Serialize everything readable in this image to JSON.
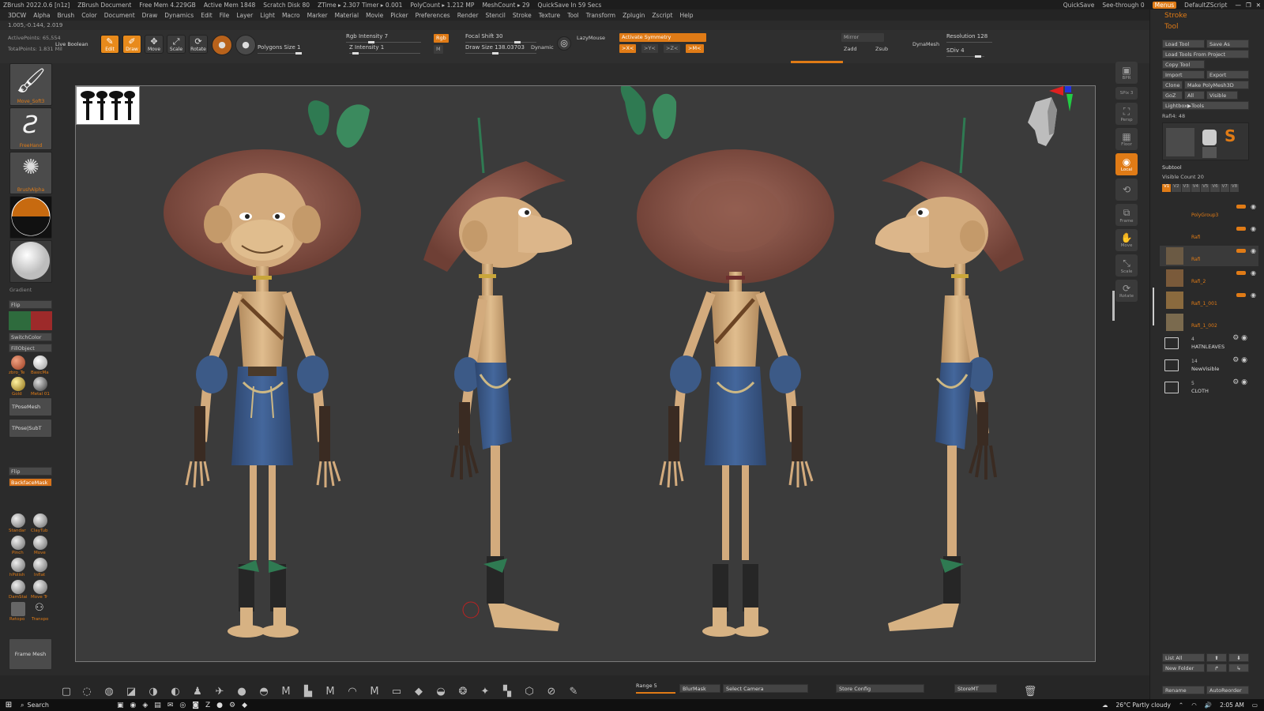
{
  "title_bar": {
    "app": "ZBrush 2022.0.6 [n1z]",
    "document": "ZBrush Document",
    "free_mem": "Free Mem 4.229GB",
    "active_mem": "Active Mem 1848",
    "scratch_disk": "Scratch Disk 80",
    "ztime": "ZTime ▸ 2.307 Timer ▸ 0.001",
    "polycount": "PolyCount ▸ 1.212 MP",
    "meshcount": "MeshCount ▸ 29",
    "quicksave": "QuickSave In 59 Secs",
    "quicksave_btn": "QuickSave",
    "see_through": "See-through 0",
    "menus_btn": "Menus",
    "script": "DefaultZScript"
  },
  "menu": [
    "3DCW",
    "Alpha",
    "Brush",
    "Color",
    "Document",
    "Draw",
    "Dynamics",
    "Edit",
    "File",
    "Layer",
    "Light",
    "Macro",
    "Marker",
    "Material",
    "Movie",
    "Picker",
    "Preferences",
    "Render",
    "Stencil",
    "Stroke",
    "Texture",
    "Tool",
    "Transform",
    "Zplugin",
    "Zscript",
    "Help"
  ],
  "coords": "1.005,-0.144, 2.019",
  "toolbar": {
    "active_points": "ActivePoints: 65,554",
    "total_points": "TotalPoints: 1.831 Mil",
    "live_boolean": "Live Boolean",
    "edit": "Edit",
    "draw": "Draw",
    "move": "Move",
    "scale": "Scale",
    "rotate": "Rotate",
    "rgb_intensity": "Rgb Intensity 7",
    "z_intensity": "Z Intensity 1",
    "polygons_size": "Polygons Size 1",
    "focal_shift": "Focal Shift 30",
    "draw_size": "Draw Size 138.03703",
    "dynamic": "Dynamic",
    "rgb": "Rgb",
    "m": "M",
    "zadd": "Zadd",
    "zsub": "Zsub",
    "lazymouse": "LazyMouse",
    "activate_symmetry": "Activate Symmetry",
    "x": ">X<",
    "y": ">Y<",
    "z": ">Z<",
    "m_sym": ">M<",
    "mirror": "Mirror",
    "dynamesh": "DynaMesh",
    "resolution": "Resolution 128",
    "sdiv": "SDiv 4"
  },
  "left_shelf": {
    "brush_label": "Move_Soft3",
    "stroke_label": "FreeHand",
    "alpha_label": "BrushAlpha",
    "gradient": "Gradient",
    "switch_color": "SwitchColor",
    "fill_object": "FillObject",
    "flip": "Flip",
    "materials": [
      "zbro_Te",
      "BasicMa",
      "Gold",
      "Metal 01"
    ],
    "tpose_mesh": "TPoseMesh",
    "tpose_subt": "TPose|SubT",
    "backface_mask": "BackfaceMask",
    "brushes": [
      "Standar",
      "ClayTub",
      "Pinch",
      "Move",
      "hPolish",
      "Inflat",
      "DamStai",
      "Move Tr",
      "Retopo",
      "Transpo"
    ],
    "frame_mesh": "Frame Mesh"
  },
  "right_strip": [
    "BPR",
    "SPix 3",
    "Persp",
    "Floor",
    "Local",
    "Frame",
    "Move",
    "Scale",
    "Rotate"
  ],
  "right_panel": {
    "stroke_title": "Stroke",
    "tool_title": "Tool",
    "load_tool": "Load Tool",
    "save_as": "Save As",
    "load_tools_from_project": "Load Tools From Project",
    "copy_tool": "Copy Tool",
    "import": "Import",
    "export": "Export",
    "clone": "Clone",
    "make_polymesh": "Make PolyMesh3D",
    "goz": "GoZ",
    "all": "All",
    "visible": "Visible",
    "lightbox_tools": "Lightbox▶Tools",
    "tool_count": "Rafi4: 48",
    "subtool_title": "Subtool",
    "visible_count": "Visible Count 20",
    "vtabs": [
      "V1",
      "V2",
      "V3",
      "V4",
      "V5",
      "V6",
      "V7",
      "V8"
    ],
    "subtools": [
      "PolyGroup3",
      "Rafi",
      "Rafi",
      "Rafi_2",
      "Rafi_1_001",
      "Rafi_1_002"
    ],
    "folders": [
      {
        "count": "4",
        "name": "HATNLEAVES"
      },
      {
        "count": "14",
        "name": "NewVisible"
      },
      {
        "count": "5",
        "name": "CLOTH"
      }
    ],
    "list_all": "List All",
    "new_folder": "New Folder",
    "rename": "Rename",
    "auto_reorder": "AutoReorder"
  },
  "bottom": {
    "range": "Range 5",
    "blur_mask": "BlurMask",
    "select_camera": "Select Camera",
    "store_config": "Store Config",
    "store_mt": "StoreMT"
  },
  "taskbar": {
    "search": "Search",
    "weather": "26°C Partly cloudy",
    "time": "2:05 AM"
  },
  "colors": {
    "accent": "#e07b16",
    "viewport_bg": "#3b3b3b",
    "skin": "#d7b283",
    "hat": "#7a4a3e",
    "shorts": "#3c5a87",
    "leaf": "#2f7a52"
  }
}
